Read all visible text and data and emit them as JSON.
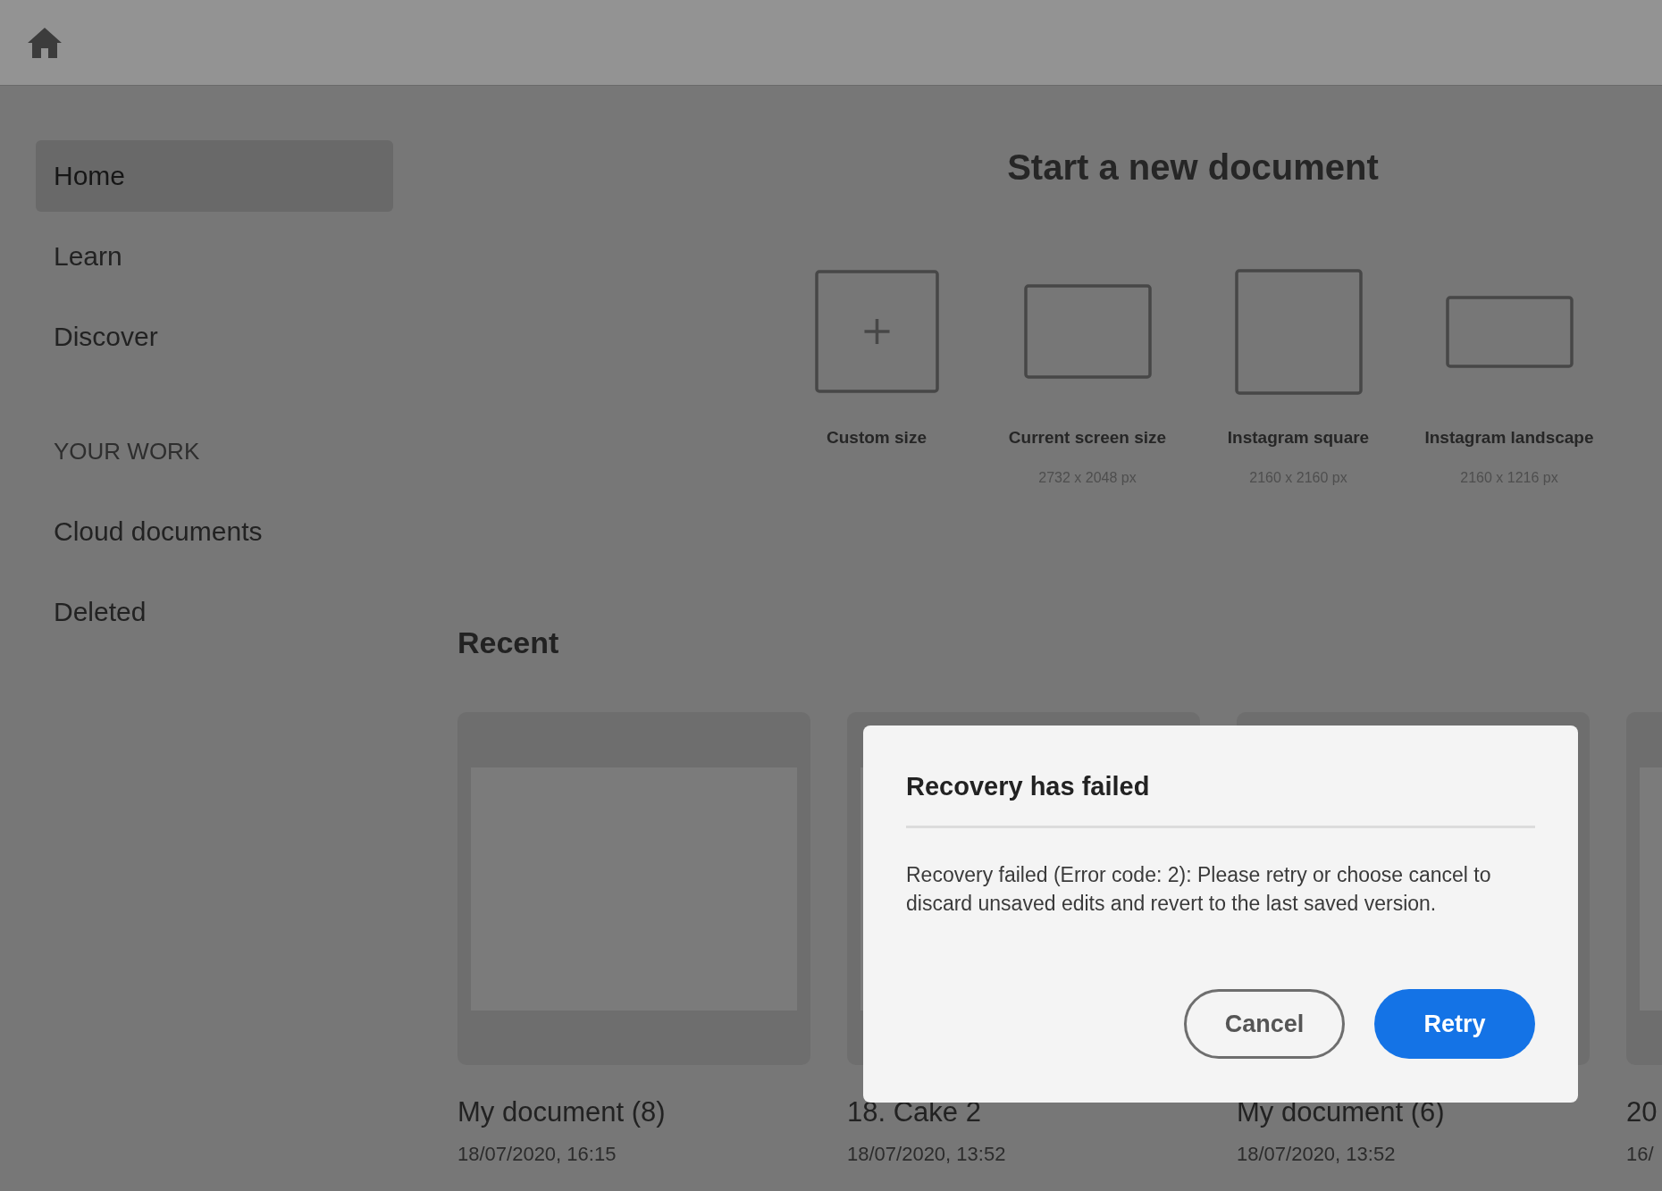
{
  "nav_items": [
    {
      "label": "Home",
      "selected": true
    },
    {
      "label": "Learn",
      "selected": false
    },
    {
      "label": "Discover",
      "selected": false
    }
  ],
  "section_title": "YOUR WORK",
  "work_items": [
    {
      "label": "Cloud documents",
      "selected": false
    },
    {
      "label": "Deleted",
      "selected": false
    }
  ],
  "new_document": {
    "title": "Start a new document",
    "presets": [
      {
        "kind": "custom",
        "label": "Custom size"
      },
      {
        "kind": "screen",
        "label": "Current screen size",
        "size": "2732 x 2048 px"
      },
      {
        "kind": "square",
        "label": "Instagram square",
        "size": "2160 x 2160 px"
      },
      {
        "kind": "landscape",
        "label": "Instagram landscape",
        "size": "2160 x 1216 px"
      }
    ]
  },
  "recent": {
    "title": "Recent",
    "documents": [
      {
        "title": "My document (8)",
        "date": "18/07/2020, 16:15",
        "thumbnail": true
      },
      {
        "title": "18. Cake 2",
        "date": "18/07/2020, 13:52",
        "thumbnail": true
      },
      {
        "title": "My document (6)",
        "date": "18/07/2020, 13:52"
      },
      {
        "title": "20",
        "date": "16/",
        "thumbnail": true
      }
    ]
  },
  "dialog": {
    "title": "Recovery has failed",
    "message": "Recovery failed (Error code: 2): Please retry or choose cancel to discard unsaved edits and revert to the last saved version.",
    "buttons": [
      {
        "label": "Cancel",
        "kind": "secondary"
      },
      {
        "label": "Retry",
        "kind": "primary"
      }
    ]
  }
}
